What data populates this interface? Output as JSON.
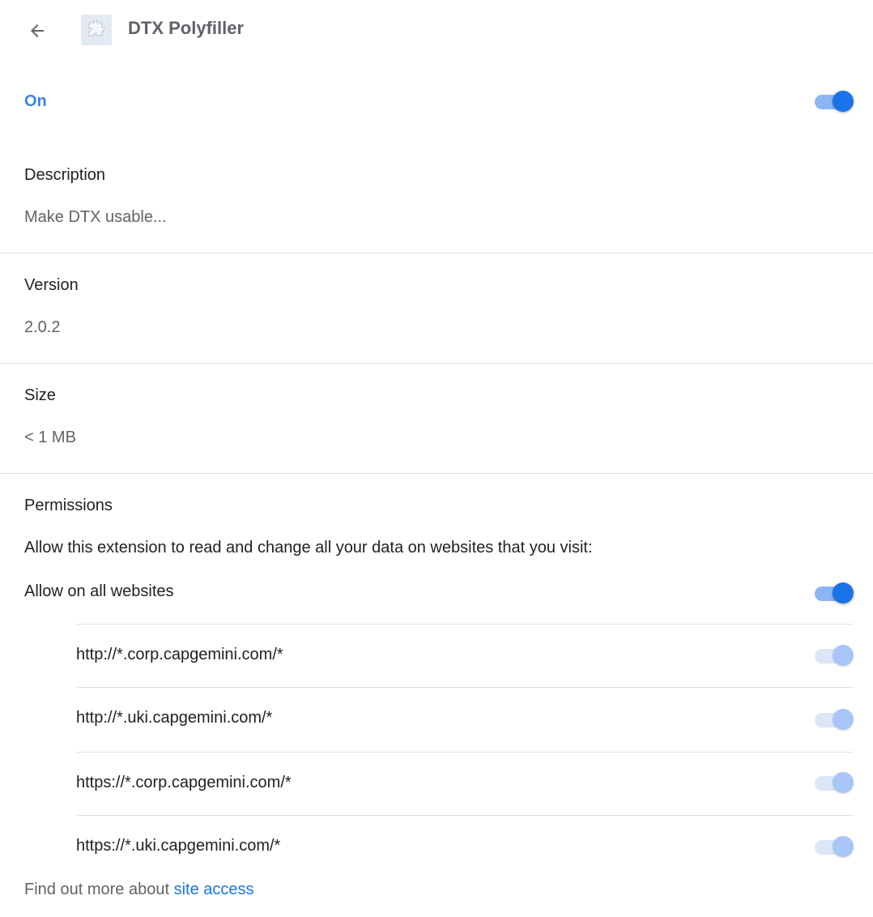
{
  "header": {
    "back_icon": "arrow-left-icon",
    "extension_icon": "puzzle-piece-icon",
    "title": "DTX Polyfiller"
  },
  "status": {
    "label": "On",
    "enabled": true,
    "accent_color": "#1a73e8"
  },
  "description": {
    "label": "Description",
    "value": "Make DTX usable..."
  },
  "version": {
    "label": "Version",
    "value": "2.0.2"
  },
  "size": {
    "label": "Size",
    "value": "< 1 MB"
  },
  "permissions": {
    "label": "Permissions",
    "intro": "Allow this extension to read and change all your data on websites that you visit:",
    "allow_all_label": "Allow on all websites",
    "allow_all_enabled": true,
    "sites": [
      {
        "url": "http://*.corp.capgemini.com/*",
        "enabled": true,
        "disabled": true
      },
      {
        "url": "http://*.uki.capgemini.com/*",
        "enabled": true,
        "disabled": true
      },
      {
        "url": "https://*.corp.capgemini.com/*",
        "enabled": true,
        "disabled": true
      },
      {
        "url": "https://*.uki.capgemini.com/*",
        "enabled": true,
        "disabled": true
      }
    ]
  },
  "footer": {
    "text": "Find out more about",
    "link_text": "site access"
  }
}
